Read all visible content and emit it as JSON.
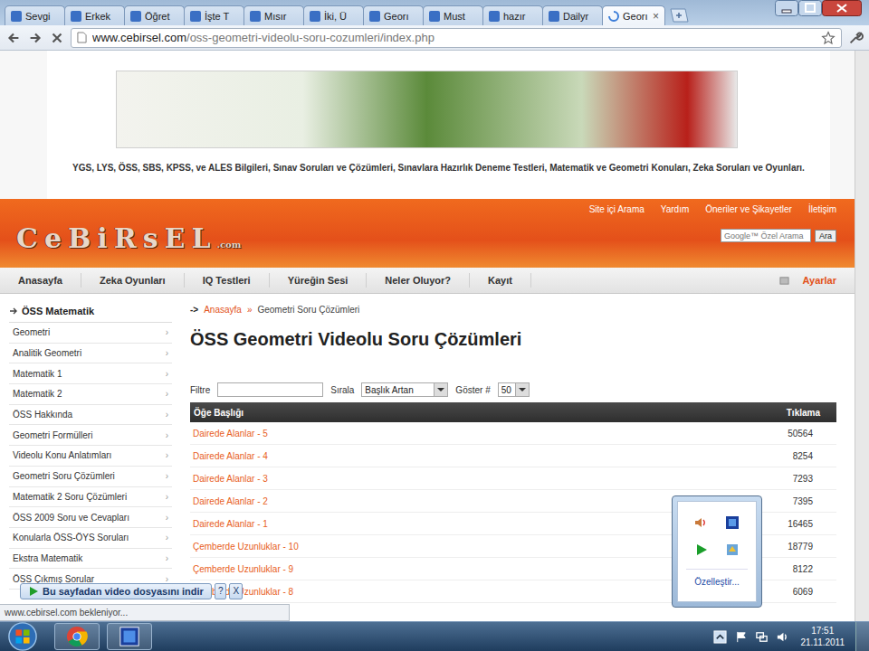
{
  "tabs": [
    {
      "label": "Sevgi",
      "selected": false
    },
    {
      "label": "Erkek",
      "selected": false
    },
    {
      "label": "Öğret",
      "selected": false
    },
    {
      "label": "İşte T",
      "selected": false
    },
    {
      "label": "Mısır",
      "selected": false
    },
    {
      "label": "İki, Ü",
      "selected": false
    },
    {
      "label": "Georı",
      "selected": false
    },
    {
      "label": "Must",
      "selected": false
    },
    {
      "label": "hazır",
      "selected": false
    },
    {
      "label": "Dailyr",
      "selected": false
    },
    {
      "label": "Georı",
      "selected": true
    }
  ],
  "tab_close": "×",
  "address_bar": {
    "domain": "www.cebirsel.com",
    "path": "/oss-geometri-videolu-soru-cozumleri/index.php"
  },
  "tagline": "YGS, LYS, ÖSS, SBS, KPSS, ve ALES Bilgileri, Sınav Soruları ve Çözümleri, Sınavlara Hazırlık Deneme Testleri, Matematik ve Geometri Konuları, Zeka Soruları ve Oyunları.",
  "header": {
    "logo": "CeBiRsEL",
    "logo_suffix": ".com",
    "links": [
      "Site içi Arama",
      "Yardım",
      "Öneriler ve Şikayetler",
      "İletişim"
    ],
    "search_placeholder": "Google™ Özel Arama",
    "search_button": "Ara"
  },
  "nav": {
    "items": [
      "Anasayfa",
      "Zeka Oyunları",
      "IQ Testleri",
      "Yüreğin Sesi",
      "Neler Oluyor?",
      "Kayıt"
    ],
    "settings": "Ayarlar"
  },
  "sidebar": {
    "title": "ÖSS Matematik",
    "arrow": "›",
    "items": [
      "Geometri",
      "Analitik Geometri",
      "Matematik 1",
      "Matematik 2",
      "ÖSS Hakkında",
      "Geometri Formülleri",
      "Videolu Konu Anlatımları",
      "Geometri Soru Çözümleri",
      "Matematik 2 Soru Çözümleri",
      "ÖSS 2009 Soru ve Cevapları",
      "Konularla ÖSS-ÖYS Soruları",
      "Ekstra Matematik",
      "ÖSS Çıkmış Sorular"
    ]
  },
  "breadcrumb": {
    "marker": "->",
    "separator": "»",
    "items": [
      "Anasayfa",
      "Geometri Soru Çözümleri"
    ]
  },
  "title": "ÖSS Geometri Videolu Soru Çözümleri",
  "filters": {
    "filter_label": "Filtre",
    "filter_value": "",
    "sort_label": "Sırala",
    "sort_value": "Başlık Artan",
    "show_label": "Göster #",
    "show_value": "50"
  },
  "table": {
    "columns": [
      "Öğe Başlığı",
      "Tıklama"
    ],
    "rows": [
      [
        "Dairede Alanlar - 5",
        "50564"
      ],
      [
        "Dairede Alanlar - 4",
        "8254"
      ],
      [
        "Dairede Alanlar - 3",
        "7293"
      ],
      [
        "Dairede Alanlar - 2",
        "7395"
      ],
      [
        "Dairede Alanlar - 1",
        "16465"
      ],
      [
        "Çemberde Uzunluklar - 10",
        "18779"
      ],
      [
        "Çemberde Uzunluklar - 9",
        "8122"
      ],
      [
        "Çemberde Uzunluklar - 8",
        "6069"
      ]
    ]
  },
  "download_bar": {
    "label": "Bu sayfadan video dosyasını indir",
    "help": "?",
    "close": "X"
  },
  "status_bubble": "www.cebirsel.com bekleniyor...",
  "tray_popup": {
    "customize": "Özelleştir..."
  },
  "taskbar": {
    "time": "17:51",
    "date": "21.11.2011"
  }
}
